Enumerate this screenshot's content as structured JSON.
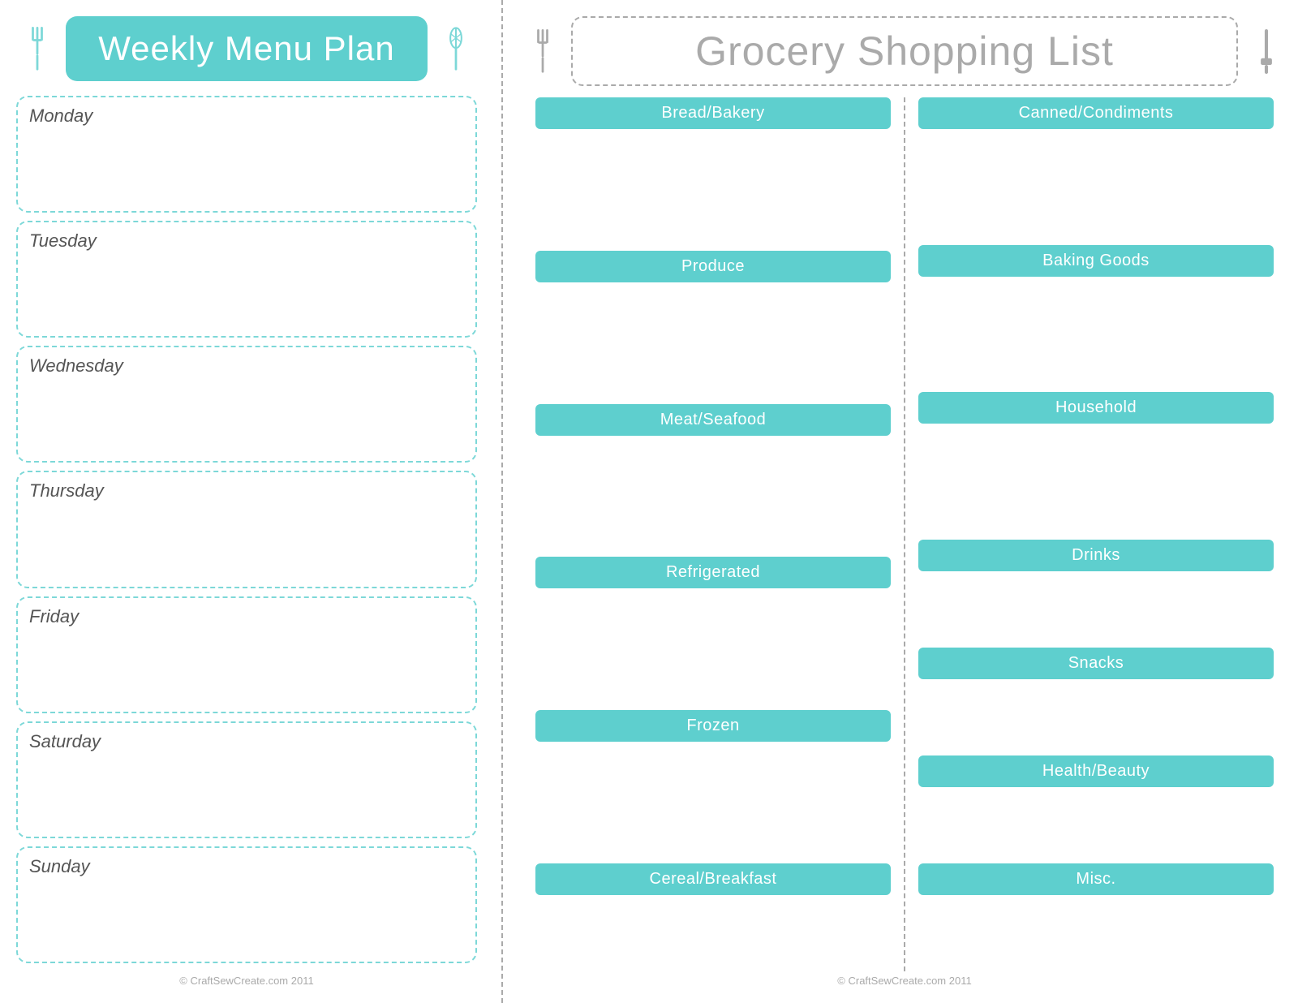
{
  "left": {
    "title": "Weekly Menu Plan",
    "days": [
      "Monday",
      "Tuesday",
      "Wednesday",
      "Thursday",
      "Friday",
      "Saturday",
      "Sunday"
    ],
    "copyright": "© CraftSewCreate.com 2011"
  },
  "right": {
    "title": "Grocery Shopping List",
    "left_categories": [
      "Bread/Bakery",
      "Produce",
      "Meat/Seafood",
      "Refrigerated",
      "Frozen",
      "Cereal/Breakfast"
    ],
    "right_categories": [
      "Canned/Condiments",
      "Baking Goods",
      "Household",
      "Drinks",
      "Snacks",
      "Health/Beauty",
      "Misc."
    ],
    "copyright": "© CraftSewCreate.com 2011"
  },
  "icons": {
    "fork_left": "🍴",
    "whisk_center": "🥄",
    "spatula_right": "🍳"
  }
}
